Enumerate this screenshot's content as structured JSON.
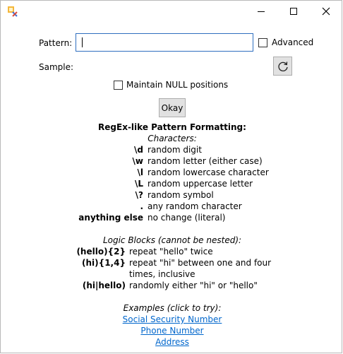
{
  "form": {
    "pattern_label": "Pattern:",
    "pattern_value": "",
    "advanced_label": "Advanced",
    "sample_label": "Sample:",
    "maintain_null_label": "Maintain NULL positions",
    "okay_label": "Okay"
  },
  "help": {
    "title": "RegEx-like Pattern Formatting:",
    "characters_heading": "Characters:",
    "characters": [
      {
        "key": "\\d",
        "desc": "random digit"
      },
      {
        "key": "\\w",
        "desc": "random letter (either case)"
      },
      {
        "key": "\\l",
        "desc": "random lowercase character"
      },
      {
        "key": "\\L",
        "desc": "random uppercase letter"
      },
      {
        "key": "\\?",
        "desc": "random symbol"
      },
      {
        "key": ".",
        "desc": "any random character"
      },
      {
        "key": "anything else",
        "desc": "no change (literal)"
      }
    ],
    "logic_heading": "Logic Blocks (cannot be nested):",
    "logic": [
      {
        "key": "(hello){2}",
        "desc": "repeat \"hello\" twice"
      },
      {
        "key": "(hi){1,4}",
        "desc": "repeat \"hi\" between one and four",
        "desc2": "times, inclusive"
      },
      {
        "key": "(hi|hello)",
        "desc": "randomly either \"hi\" or \"hello\""
      }
    ],
    "examples_heading": "Examples (click to try):",
    "examples": [
      "Social Security Number",
      "Phone Number",
      "Address"
    ]
  }
}
